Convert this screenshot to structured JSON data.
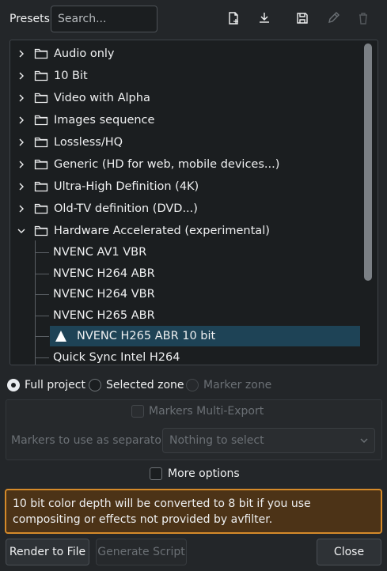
{
  "header": {
    "presets_label": "Presets",
    "search_placeholder": "Search..."
  },
  "toolbar_icons": [
    "new-preset-icon",
    "download-icon",
    "save-icon",
    "edit-icon",
    "delete-icon"
  ],
  "tree": {
    "categories": [
      {
        "label": "Audio only",
        "expanded": false
      },
      {
        "label": "10 Bit",
        "expanded": false
      },
      {
        "label": "Video with Alpha",
        "expanded": false
      },
      {
        "label": "Images sequence",
        "expanded": false
      },
      {
        "label": "Lossless/HQ",
        "expanded": false
      },
      {
        "label": "Generic (HD for web, mobile devices...)",
        "expanded": false
      },
      {
        "label": "Ultra-High Definition (4K)",
        "expanded": false
      },
      {
        "label": "Old-TV definition (DVD...)",
        "expanded": false
      },
      {
        "label": "Hardware Accelerated (experimental)",
        "expanded": true
      }
    ],
    "children": [
      {
        "label": "NVENC AV1 VBR",
        "selected": false,
        "warning": false
      },
      {
        "label": "NVENC H264 ABR",
        "selected": false,
        "warning": false
      },
      {
        "label": "NVENC H264 VBR",
        "selected": false,
        "warning": false
      },
      {
        "label": "NVENC H265 ABR",
        "selected": false,
        "warning": false
      },
      {
        "label": "NVENC H265 ABR 10 bit",
        "selected": true,
        "warning": true
      },
      {
        "label": "Quick Sync Intel H264",
        "selected": false,
        "warning": false
      }
    ]
  },
  "render_range": {
    "full_project": "Full project",
    "selected_zone": "Selected zone",
    "marker_zone": "Marker zone",
    "selected": "full_project"
  },
  "markers": {
    "multi_export_label": "Markers Multi-Export",
    "separator_label": "Markers to use as separator:",
    "separator_value": "Nothing to select"
  },
  "more_options_label": "More options",
  "warning_text": "10 bit color depth will be converted to 8 bit if you use compositing or effects not provided by avfilter.",
  "buttons": {
    "render": "Render to File",
    "generate_script": "Generate Script",
    "close": "Close"
  },
  "colors": {
    "background": "#232629",
    "selection": "#1e4356",
    "warning_border": "#d58a2a",
    "warning_background": "#4c3317"
  }
}
